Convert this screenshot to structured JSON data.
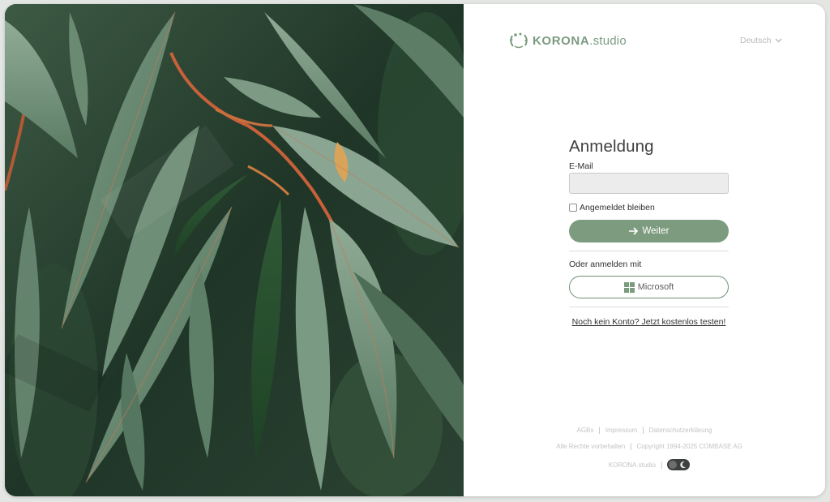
{
  "brand": {
    "logo_bold": "KORONA",
    "logo_light": ".studio",
    "color": "#7d9b7f"
  },
  "language": {
    "selected": "Deutsch"
  },
  "login": {
    "title": "Anmeldung",
    "email_label": "E-Mail",
    "email_value": "",
    "remember_label": "Angemeldet bleiben",
    "remember_checked": false,
    "next_button": "Weiter",
    "or_label": "Oder anmelden mit",
    "microsoft_button": "Microsoft",
    "signup_link": "Noch kein Konto? Jetzt kostenlos testen!"
  },
  "footer": {
    "links": [
      "AGBs",
      "Impressum",
      "Datenschutzerklärung"
    ],
    "rights": "Alle Rechte vorbehalten",
    "copyright": "Copyright 1994-2025 COMBASE AG",
    "product": "KORONA.studio",
    "theme_toggle": "dark-mode-toggle"
  },
  "icons": {
    "logo": "wreath-logo-icon",
    "language_chevron": "chevron-down-icon",
    "next": "arrow-right-icon",
    "microsoft": "microsoft-logo-icon",
    "theme": "moon-icon"
  }
}
